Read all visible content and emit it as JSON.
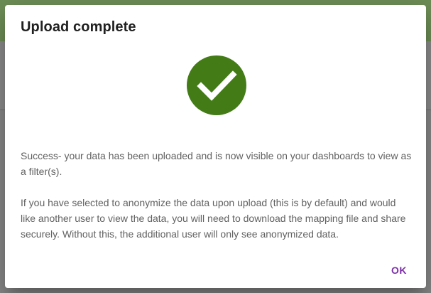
{
  "dialog": {
    "title": "Upload complete",
    "icon": "check-circle-icon",
    "icon_color": "#437c17",
    "message_success": "Success- your data has been uploaded and is now visible on your dashboards to view as a filter(s).",
    "message_anonymize": "If you have selected to anonymize the data upon upload (this is by default) and would like another user to view the data, you will need to download the mapping file and share securely. Without this, the additional user will only see anonymized data.",
    "ok_label": "OK",
    "ok_color": "#7b2fa8"
  }
}
